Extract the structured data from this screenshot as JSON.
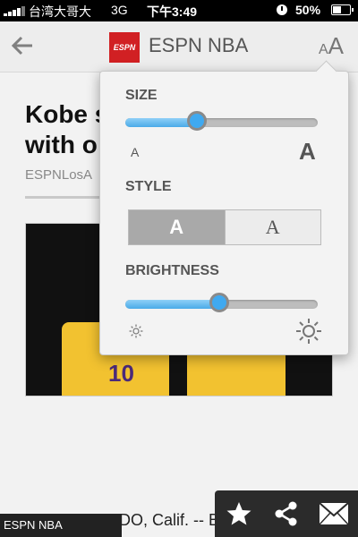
{
  "status_bar": {
    "carrier": "台湾大哥大",
    "network": "3G",
    "time": "下午3:49",
    "battery": "50%",
    "battery_level": 0.5
  },
  "nav": {
    "back_icon": "back-arrow-icon",
    "logo_text": "ESPN",
    "title": "ESPN NBA",
    "text_size_small": "A",
    "text_size_large": "A"
  },
  "article": {
    "headline": "Kobe s\nwith o",
    "byline": "ESPNLosA",
    "body_snippet": "NDO, Calif. -- By vi.tue",
    "photo_jersey_number": "10"
  },
  "text_settings": {
    "size_label": "SIZE",
    "size_level": 0.37,
    "size_min_label": "A",
    "size_max_label": "A",
    "style_label": "STYLE",
    "style_options": [
      "A",
      "A"
    ],
    "style_selected": "sans",
    "brightness_label": "BRIGHTNESS",
    "brightness_level": 0.49
  },
  "toolbar": {
    "buttons": [
      "star-icon",
      "share-icon",
      "mail-icon"
    ]
  },
  "source_tab": "ESPN NBA",
  "colors": {
    "espn_red": "#d12023",
    "slider_blue": "#3fa9f0"
  }
}
